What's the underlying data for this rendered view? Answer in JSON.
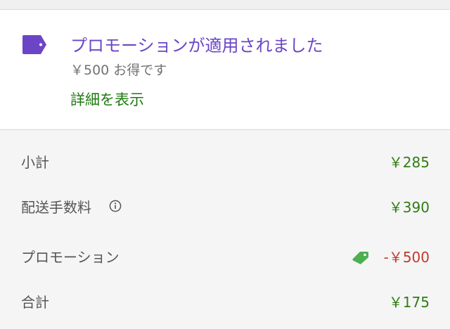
{
  "promotion": {
    "icon": "price-tag-icon",
    "title": "プロモーションが適用されました",
    "saving": "￥500 お得です",
    "details_link": "詳細を表示",
    "accent_color": "#6b45c6"
  },
  "summary": {
    "subtotal": {
      "label": "小計",
      "value": "￥285"
    },
    "delivery_fee": {
      "label": "配送手数料",
      "value": "￥390",
      "icon": "info-icon"
    },
    "promotion": {
      "label": "プロモーション",
      "value": "-￥500",
      "icon": "green-tag-icon"
    },
    "total": {
      "label": "合計",
      "value": "￥175"
    },
    "value_color": "#2f7d14",
    "discount_color": "#c33a2f"
  }
}
